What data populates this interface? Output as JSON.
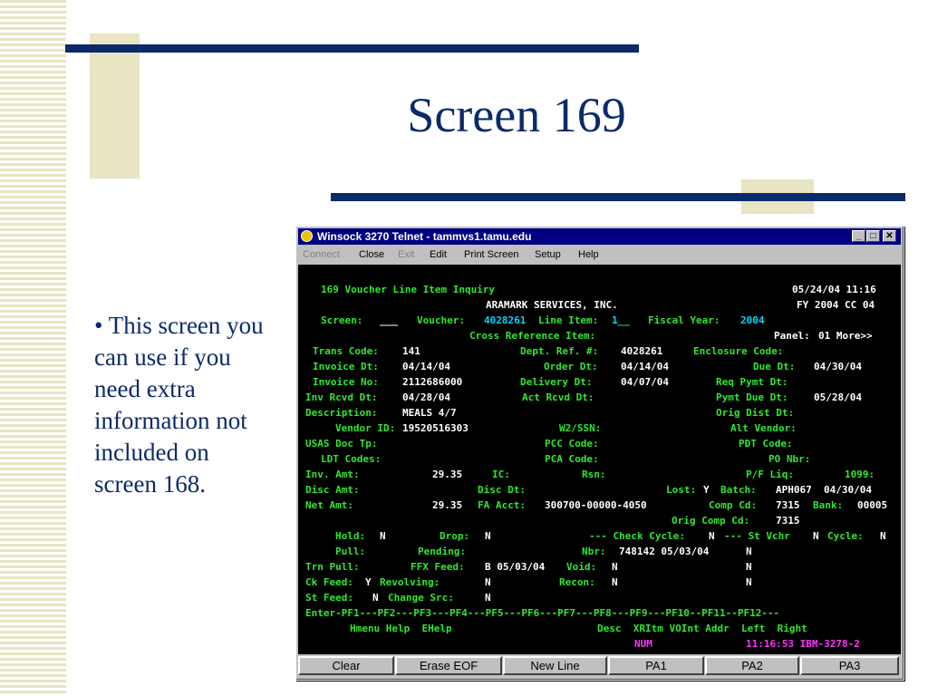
{
  "slide": {
    "title": "Screen 169",
    "bullet": "• This screen you can use if you need extra information not included on screen 168."
  },
  "window": {
    "title": "Winsock 3270 Telnet - tammvs1.tamu.edu",
    "menu": [
      "Connect",
      "Close",
      "Exit",
      "Edit",
      "Print Screen",
      "Setup",
      "Help"
    ]
  },
  "terminal": {
    "title": "169 Voucher Line Item Inquiry",
    "date_time": "05/24/04 11:16",
    "vendor_name": "ARAMARK SERVICES, INC.",
    "fy_cc": "FY 2004 CC 04",
    "screen_label": "Screen:",
    "screen_value": "___",
    "voucher_label": "Voucher:",
    "voucher_value": "4028261",
    "line_item_label": "Line Item:",
    "line_item_value": "1__",
    "fiscal_year_label": "Fiscal Year:",
    "fiscal_year_value": "2004",
    "cross_ref_label": "Cross Reference Item:",
    "panel_label": "Panel:",
    "panel_value": "01 More>>",
    "trans_code_label": "Trans Code:",
    "trans_code_value": "141",
    "dept_ref_label": "Dept. Ref. #:",
    "dept_ref_value": "4028261",
    "enclosure_label": "Enclosure Code:",
    "invoice_dt_label": "Invoice Dt:",
    "invoice_dt_value": "04/14/04",
    "order_dt_label": "Order Dt:",
    "order_dt_value": "04/14/04",
    "due_dt_label": "Due Dt:",
    "due_dt_value": "04/30/04",
    "invoice_no_label": "Invoice No:",
    "invoice_no_value": "2112686000",
    "delivery_dt_label": "Delivery Dt:",
    "delivery_dt_value": "04/07/04",
    "req_pymt_label": "Req Pymt Dt:",
    "inv_rcvd_label": "Inv Rcvd Dt:",
    "inv_rcvd_value": "04/28/04",
    "act_rcvd_label": "Act Rcvd Dt:",
    "pymt_due_label": "Pymt Due Dt:",
    "pymt_due_value": "05/28/04",
    "description_label": "Description:",
    "description_value": "MEALS 4/7",
    "orig_dist_label": "Orig Dist Dt:",
    "vendor_id_label": "Vendor ID:",
    "vendor_id_value": "19520516303",
    "w2ssn_label": "W2/SSN:",
    "alt_vendor_label": "Alt Vendor:",
    "usas_label": "USAS Doc Tp:",
    "pcc_label": "PCC Code:",
    "pdt_label": "PDT Code:",
    "ldt_label": "LDT Codes:",
    "pca_label": "PCA Code:",
    "po_label": "PO Nbr:",
    "inv_amt_label": "Inv. Amt:",
    "inv_amt_value": "29.35",
    "ic_label": "IC:",
    "rsn_label": "Rsn:",
    "pf_liq_label": "P/F Liq:",
    "p1099_label": "1099:",
    "disc_amt_label": "Disc Amt:",
    "disc_dt_label": "Disc Dt:",
    "lost_label": "Lost:",
    "lost_value": "Y",
    "batch_label": "Batch:",
    "batch_value": "APH067  04/30/04",
    "net_amt_label": "Net Amt:",
    "net_amt_value": "29.35",
    "fa_acct_label": "FA Acct:",
    "fa_acct_value": "300700-00000-4050",
    "comp_cd_label": "Comp Cd:",
    "comp_cd_value": "7315",
    "bank_label": "Bank:",
    "bank_value": "00005",
    "orig_comp_label": "Orig Comp Cd:",
    "orig_comp_value": "7315",
    "hold_label": "Hold:",
    "hold_value": "N",
    "drop_label": "Drop:",
    "drop_value": "N",
    "check_cycle_label": "--- Check Cycle:",
    "check_cycle_value": "N",
    "st_vchr_label": "--- St Vchr",
    "st_vchr_value": "N",
    "cycle_label": "Cycle:",
    "cycle_value": "N",
    "pull_label": "Pull:",
    "pending_label": "Pending:",
    "nbr_label": "Nbr:",
    "nbr_value": "748142 05/03/04",
    "nbr_flag": "N",
    "trn_pull_label": "Trn Pull:",
    "ffx_label": "FFX Feed:",
    "ffx_value": "B 05/03/04",
    "void_label": "Void:",
    "void_value": "N",
    "void_flag": "N",
    "ck_feed_label": "Ck Feed:",
    "ck_feed_value": "Y",
    "revolving_label": "Revolving:",
    "revolving_value": "N",
    "recon_label": "Recon:",
    "recon_value": "N",
    "recon_flag": "N",
    "st_feed_label": "St Feed:",
    "st_feed_value": "N",
    "change_src_label": "Change Src:",
    "change_src_value": "N",
    "pf_line": "Enter-PF1---PF2---PF3---PF4---PF5---PF6---PF7---PF8---PF9---PF10--PF11--PF12---",
    "pf_desc_a": "Hmenu Help  EHelp",
    "pf_desc_b": "Desc  XRItm VOInt Addr  Left  Right",
    "status_num": "NUM",
    "status_time": "11:16:53 IBM-3278-2"
  },
  "pf_buttons": [
    "Clear",
    "Erase EOF",
    "New Line",
    "PA1",
    "PA2",
    "PA3"
  ]
}
